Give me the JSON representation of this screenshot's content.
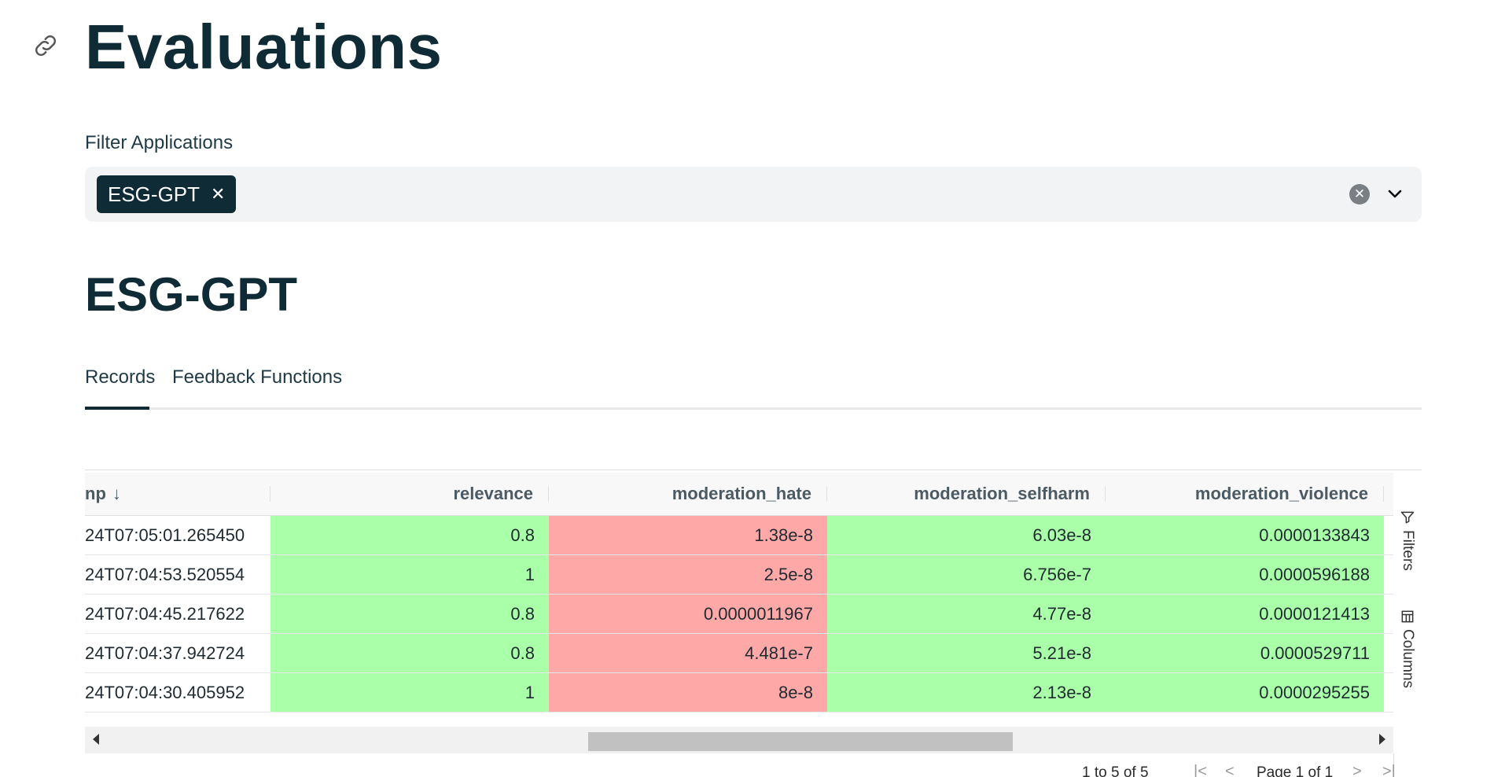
{
  "page": {
    "title": "Evaluations"
  },
  "filter": {
    "label": "Filter Applications",
    "selected": [
      {
        "label": "ESG-GPT",
        "remove_glyph": "✕"
      }
    ],
    "clear_icon": "clear-circle-icon",
    "dropdown_icon": "chevron-down-icon"
  },
  "app": {
    "name": "ESG-GPT"
  },
  "tabs": [
    {
      "label": "Records",
      "active": true
    },
    {
      "label": "Feedback Functions",
      "active": false
    }
  ],
  "table": {
    "columns": [
      {
        "label": "np",
        "sorted": "desc"
      },
      {
        "label": "relevance"
      },
      {
        "label": "moderation_hate"
      },
      {
        "label": "moderation_selfharm"
      },
      {
        "label": "moderation_violence"
      }
    ],
    "rows": [
      {
        "ts": "24T07:05:01.265450",
        "relevance": "0.8",
        "hate": "1.38e-8",
        "selfharm": "6.03e-8",
        "violence": "0.0000133843"
      },
      {
        "ts": "24T07:04:53.520554",
        "relevance": "1",
        "hate": "2.5e-8",
        "selfharm": "6.756e-7",
        "violence": "0.0000596188"
      },
      {
        "ts": "24T07:04:45.217622",
        "relevance": "0.8",
        "hate": "0.0000011967",
        "selfharm": "4.77e-8",
        "violence": "0.0000121413"
      },
      {
        "ts": "24T07:04:37.942724",
        "relevance": "0.8",
        "hate": "4.481e-7",
        "selfharm": "5.21e-8",
        "violence": "0.0000529711"
      },
      {
        "ts": "24T07:04:30.405952",
        "relevance": "1",
        "hate": "8e-8",
        "selfharm": "2.13e-8",
        "violence": "0.0000295255"
      }
    ],
    "colors": {
      "pass": "#aaffa9",
      "fail": "#ffa8a8"
    },
    "side_panel": {
      "filters_label": "Filters",
      "columns_label": "Columns"
    },
    "footer": {
      "count_text": "1 to 5 of 5",
      "page_text": "Page 1 of 1"
    }
  }
}
